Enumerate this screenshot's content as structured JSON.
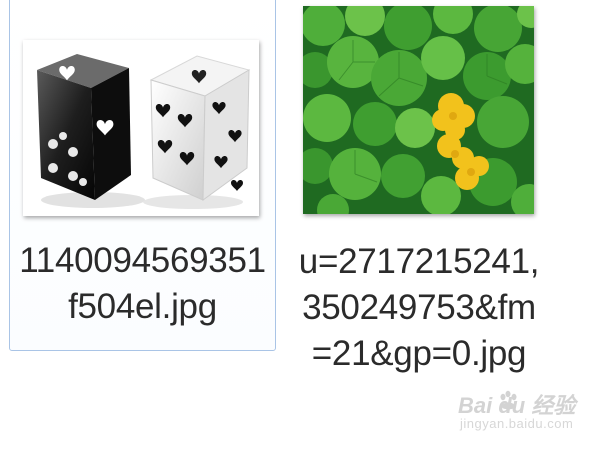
{
  "files": [
    {
      "name": "1140094569351\nf504el.jpg",
      "thumbnail": "dice-image",
      "selected": true
    },
    {
      "name": "u=2717215241,\n350249753&fm\n=21&gp=0.jpg",
      "thumbnail": "clover-flower-image",
      "selected": false
    }
  ],
  "watermark": {
    "brand": "Bai du 经验",
    "site": "jingyan.baidu.com"
  },
  "colors": {
    "selection_border": "#a9c4e6",
    "text": "#2b2b2b",
    "background": "#ffffff"
  }
}
